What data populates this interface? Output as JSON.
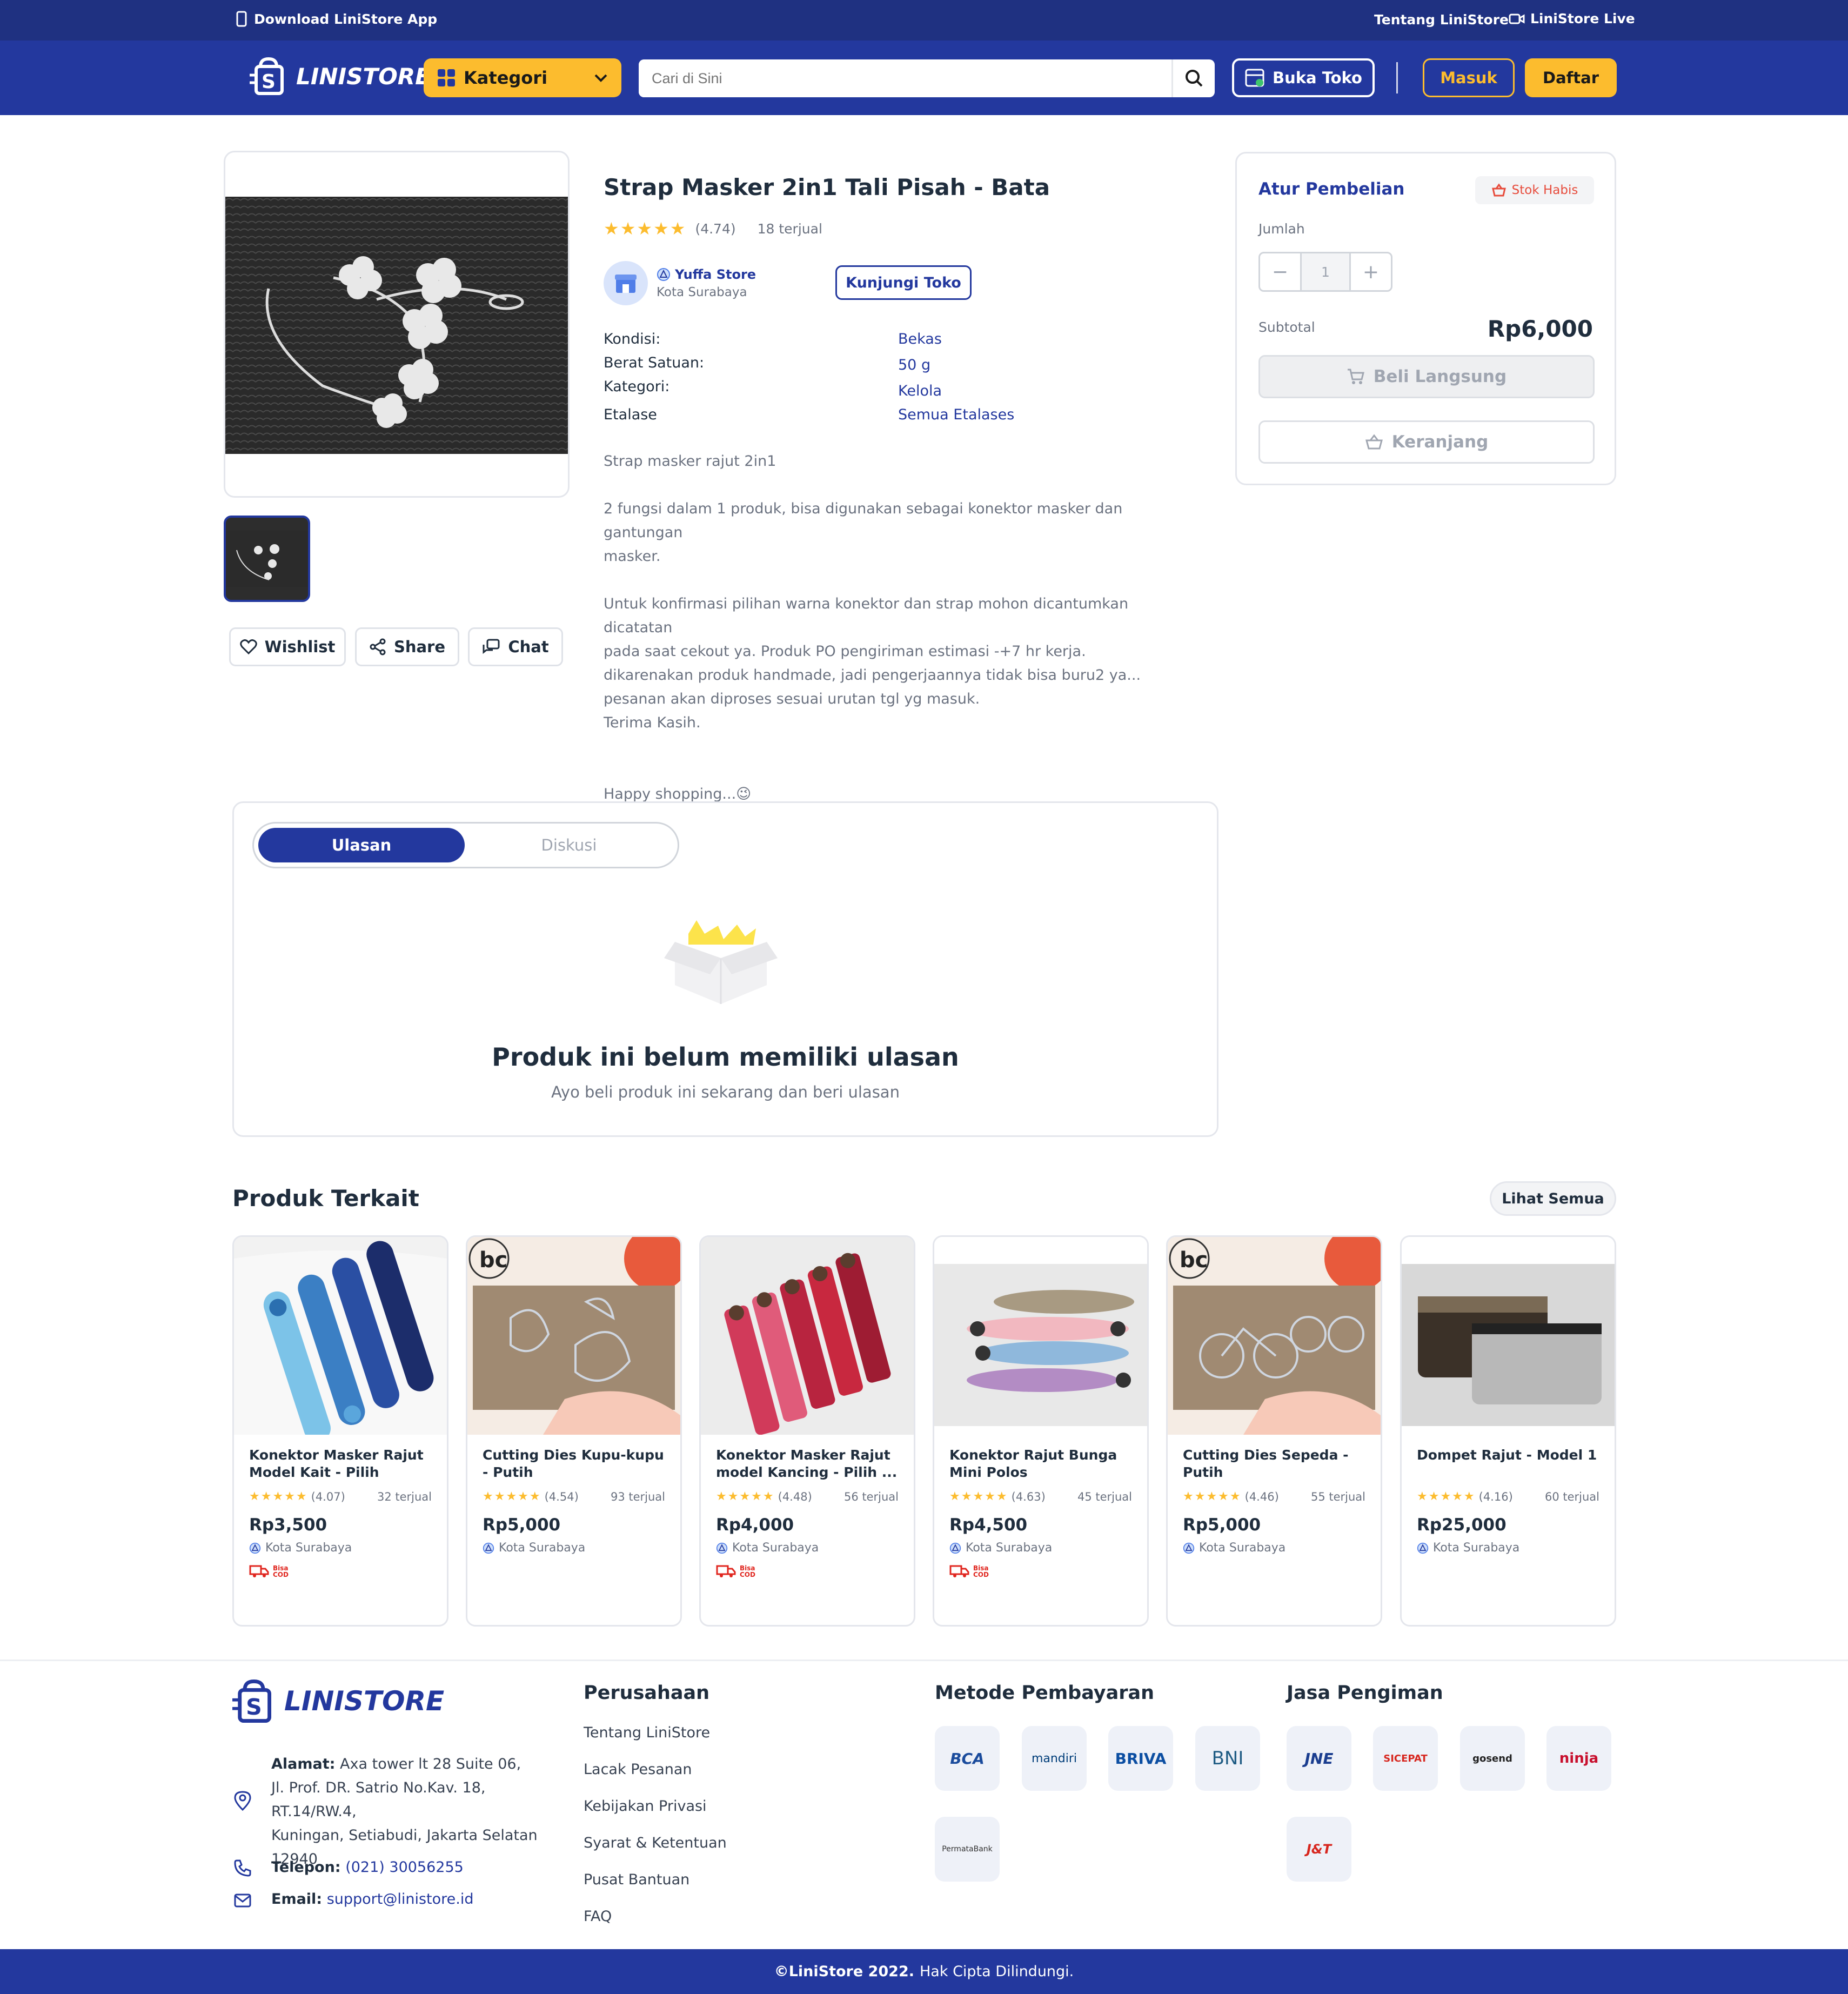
{
  "topbar": {
    "download_app": "Download LiniStore App",
    "about": "Tentang LiniStore",
    "live": "LiniStore Live"
  },
  "header": {
    "logo": "LINISTORE",
    "category_label": "Kategori",
    "search_placeholder": "Cari di Sini",
    "open_shop": "Buka Toko",
    "login": "Masuk",
    "register": "Daftar"
  },
  "colors": {
    "primary": "#23389e",
    "topbar": "#1f3181",
    "accent": "#fcbc2e",
    "danger": "#e74c3c"
  },
  "product": {
    "title": "Strap Masker 2in1 Tali Pisah - Bata",
    "rating": "(4.74)",
    "sold": "18 terjual",
    "store_name": "Yuffa Store",
    "store_city": "Kota Surabaya",
    "visit_store": "Kunjungi Toko",
    "details": [
      {
        "label": "Kondisi:",
        "value": "Bekas"
      },
      {
        "label": "Berat Satuan:",
        "value": "50 g"
      },
      {
        "label": "Kategori:",
        "value": "Kelola"
      },
      {
        "label": "Etalase",
        "value": "Semua Etalases"
      }
    ],
    "description": [
      "Strap masker rajut 2in1",
      "",
      "2 fungsi dalam 1 produk, bisa digunakan sebagai konektor masker dan gantungan",
      "masker.",
      "",
      "Untuk konfirmasi pilihan warna konektor dan strap mohon dicantumkan dicatatan",
      "pada saat cekout ya. Produk PO pengiriman estimasi -+7 hr kerja.",
      "dikarenakan produk handmade, jadi pengerjaannya tidak bisa buru2 ya...",
      "pesanan akan diproses sesuai urutan tgl yg masuk.",
      "Terima Kasih.",
      "",
      "",
      "Happy shopping...😉"
    ],
    "actions": {
      "wishlist": "Wishlist",
      "share": "Share",
      "chat": "Chat"
    }
  },
  "purchase": {
    "title": "Atur Pembelian",
    "stock_badge": "Stok Habis",
    "qty_label": "Jumlah",
    "qty_value": "1",
    "subtotal_label": "Subtotal",
    "subtotal_value": "Rp6,000",
    "buy_now": "Beli Langsung",
    "cart": "Keranjang"
  },
  "reviews": {
    "tab_active": "Ulasan",
    "tab_inactive": "Diskusi",
    "empty_title": "Produk ini belum memiliki ulasan",
    "empty_sub": "Ayo beli produk ini sekarang dan beri ulasan"
  },
  "related": {
    "title": "Produk Terkait",
    "see_all": "Lihat Semua",
    "cod_label": "Bisa COD",
    "items": [
      {
        "name": "Konektor Masker Rajut Model Kait - Pilih Warna, ...",
        "rating": "(4.07)",
        "sold": "32 terjual",
        "price": "Rp3,500",
        "city": "Kota Surabaya",
        "cod": true
      },
      {
        "name": "Cutting Dies Kupu-kupu - Putih",
        "rating": "(4.54)",
        "sold": "93 terjual",
        "price": "Rp5,000",
        "city": "Kota Surabaya",
        "cod": false
      },
      {
        "name": "Konektor Masker Rajut model Kancing - Pilih ...",
        "rating": "(4.48)",
        "sold": "56 terjual",
        "price": "Rp4,000",
        "city": "Kota Surabaya",
        "cod": true
      },
      {
        "name": "Konektor Rajut Bunga Mini Polos",
        "rating": "(4.63)",
        "sold": "45 terjual",
        "price": "Rp4,500",
        "city": "Kota Surabaya",
        "cod": true
      },
      {
        "name": "Cutting Dies Sepeda - Putih",
        "rating": "(4.46)",
        "sold": "55 terjual",
        "price": "Rp5,000",
        "city": "Kota Surabaya",
        "cod": false
      },
      {
        "name": "Dompet Rajut - Model 1",
        "rating": "(4.16)",
        "sold": "60 terjual",
        "price": "Rp25,000",
        "city": "Kota Surabaya",
        "cod": false
      }
    ]
  },
  "footer": {
    "logo": "LINISTORE",
    "address_label": "Alamat:",
    "address_lines": [
      "Axa tower lt 28 Suite 06,",
      "Jl. Prof. DR. Satrio No.Kav. 18, RT.14/RW.4,",
      "Kuningan, Setiabudi, Jakarta Selatan",
      "12940"
    ],
    "phone_label": "Telepon:",
    "phone": "(021) 30056255",
    "email_label": "Email:",
    "email": "support@linistore.id",
    "company_title": "Perusahaan",
    "company_links": [
      "Tentang LiniStore",
      "Lacak Pesanan",
      "Kebijakan Privasi",
      "Syarat & Ketentuan",
      "Pusat Bantuan",
      "FAQ"
    ],
    "payment_title": "Metode Pembayaran",
    "payments": [
      "BCA",
      "mandiri",
      "BRIVA",
      "BNI",
      "PermataBank"
    ],
    "shipping_title": "Jasa Pengiman",
    "shipping": [
      "JNE",
      "SICEPAT",
      "gosend",
      "ninja",
      "J&T"
    ],
    "copyright_bold": "©LiniStore 2022.",
    "copyright_rest": "Hak Cipta Dilindungi."
  }
}
